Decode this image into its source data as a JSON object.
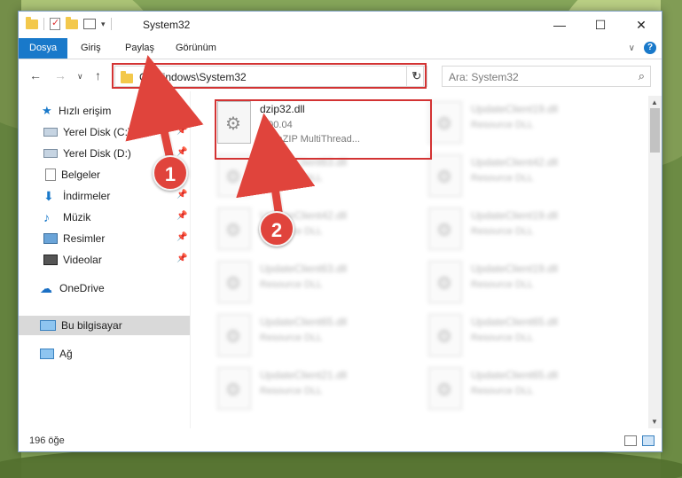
{
  "window": {
    "title": "System32",
    "minimize": "—",
    "maximize": "☐",
    "close": "✕"
  },
  "ribbon": {
    "tabs": [
      {
        "label": "Dosya",
        "active": true
      },
      {
        "label": "Giriş"
      },
      {
        "label": "Paylaş"
      },
      {
        "label": "Görünüm"
      }
    ],
    "expand": "∨",
    "help": "?"
  },
  "nav": {
    "back": "←",
    "forward": "→",
    "recent": "∨",
    "up": "↑",
    "address": "C:\\Windows\\System32",
    "address_dropdown": "∨",
    "refresh": "↻",
    "search_placeholder": "Ara: System32",
    "search_icon": "⌕"
  },
  "sidebar": {
    "items": [
      {
        "label": "Hızlı erişim",
        "icon": "star-icon"
      },
      {
        "label": "Yerel Disk (C:)",
        "icon": "disk-icon",
        "pinned": true
      },
      {
        "label": "Yerel Disk (D:)",
        "icon": "disk-icon",
        "pinned": true
      },
      {
        "label": "Belgeler",
        "icon": "document-icon",
        "pinned": true
      },
      {
        "label": "İndirmeler",
        "icon": "download-icon",
        "pinned": true
      },
      {
        "label": "Müzik",
        "icon": "music-icon",
        "pinned": true
      },
      {
        "label": "Resimler",
        "icon": "pictures-icon",
        "pinned": true
      },
      {
        "label": "Videolar",
        "icon": "videos-icon",
        "pinned": true
      },
      {
        "label": "OneDrive",
        "icon": "cloud-icon"
      },
      {
        "label": "Bu bilgisayar",
        "icon": "computer-icon",
        "selected": true
      },
      {
        "label": "Ağ",
        "icon": "network-icon"
      }
    ],
    "pin_glyph": "📌"
  },
  "files": [
    {
      "name": "dzip32.dll",
      "line2": "4.00.04",
      "line3": "DynaZIP MultiThread...",
      "highlighted": true
    },
    {
      "name": "UpdateClient19.dll",
      "line2": "Resource DLL"
    },
    {
      "name": "UpdateClient63.dll",
      "line2": "Resource DLL"
    },
    {
      "name": "UpdateClient42.dll",
      "line2": "Resource DLL"
    },
    {
      "name": "UpdateClient42.dll",
      "line2": "Resource DLL"
    },
    {
      "name": "UpdateClient19.dll",
      "line2": "Resource DLL"
    },
    {
      "name": "UpdateClient63.dll",
      "line2": "Resource DLL"
    },
    {
      "name": "UpdateClient19.dll",
      "line2": "Resource DLL"
    },
    {
      "name": "UpdateClient65.dll",
      "line2": "Resource DLL"
    },
    {
      "name": "UpdateClient65.dll",
      "line2": "Resource DLL"
    },
    {
      "name": "UpdateClient21.dll",
      "line2": "Resource DLL"
    },
    {
      "name": "UpdateClient65.dll",
      "line2": "Resource DLL"
    }
  ],
  "status": {
    "count": "196 öğe"
  },
  "annotations": {
    "badge1": "1",
    "badge2": "2",
    "color": "#e0443c"
  }
}
